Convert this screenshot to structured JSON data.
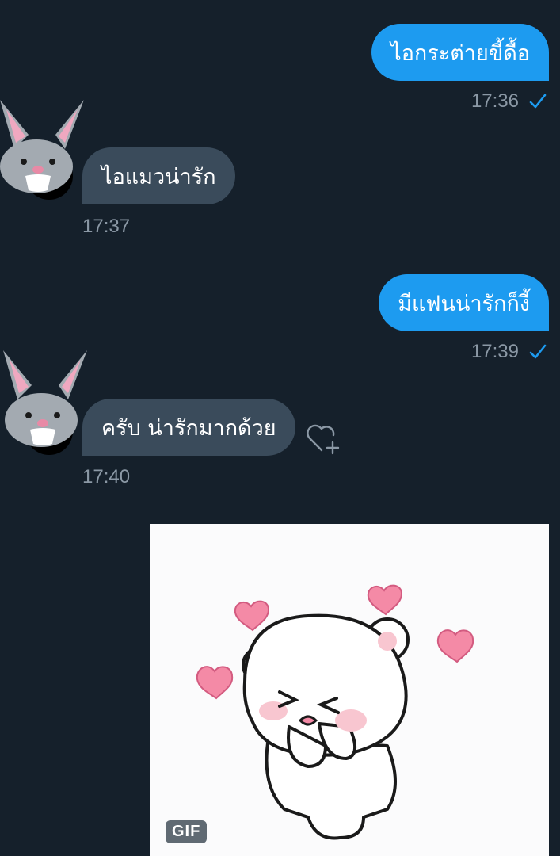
{
  "colors": {
    "background": "#15202b",
    "outgoing_bubble": "#1d9bf0",
    "incoming_bubble": "#3a4b5b",
    "timestamp": "#8b98a5",
    "read_check": "#1d9bf0"
  },
  "messages": [
    {
      "direction": "outgoing",
      "text": "ไอกระต่ายขี้ดื้อ",
      "time": "17:36",
      "status_icon": "read-check-icon"
    },
    {
      "direction": "incoming",
      "text": "ไอแมวน่ารัก",
      "time": "17:37",
      "avatar_icon": "rabbit-avatar-icon"
    },
    {
      "direction": "outgoing",
      "text": "มีแฟนน่ารักก็งี้",
      "time": "17:39",
      "status_icon": "read-check-icon"
    },
    {
      "direction": "incoming",
      "text": "ครับ น่ารักมากด้วย",
      "time": "17:40",
      "avatar_icon": "rabbit-avatar-icon",
      "action_icon": "add-reaction-heart-icon"
    }
  ],
  "gif": {
    "badge": "GIF",
    "description_icon": "bear-hearts-gif"
  }
}
